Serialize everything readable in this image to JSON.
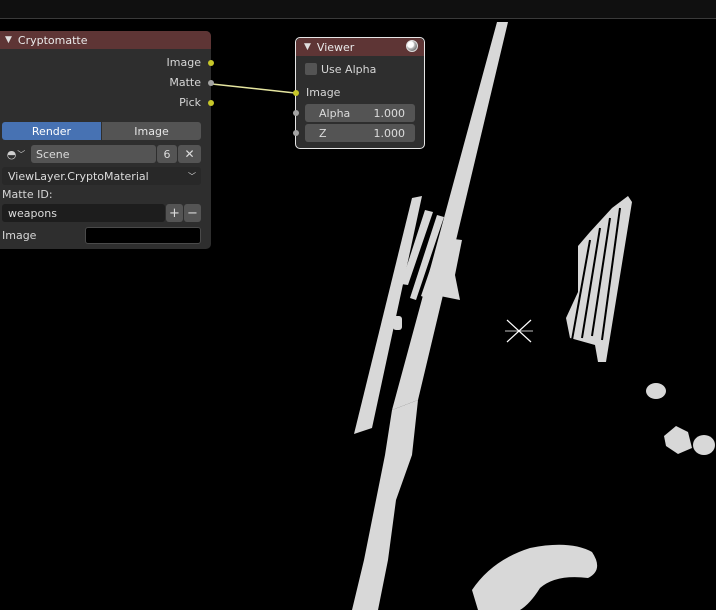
{
  "cryptomatte": {
    "title": "Cryptomatte",
    "outputs": [
      "Image",
      "Matte",
      "Pick"
    ],
    "source_tabs": [
      "Render",
      "Image"
    ],
    "active_tab": "Render",
    "scene": {
      "name": "Scene",
      "users": "6"
    },
    "layer": "ViewLayer.CryptoMaterial",
    "matte_id_label": "Matte ID:",
    "matte_id_value": "weapons",
    "image_label": "Image"
  },
  "viewer": {
    "title": "Viewer",
    "use_alpha_label": "Use Alpha",
    "use_alpha": false,
    "image_label": "Image",
    "alpha_label": "Alpha",
    "alpha_value": "1.000",
    "z_label": "Z",
    "z_value": "1.000"
  },
  "icons": {
    "collapse": "chevron-down-icon",
    "viewer_node": "viewer-sphere-icon",
    "scene": "scene-icon",
    "close": "close-icon",
    "add": "plus-icon",
    "remove": "minus-icon",
    "cursor": "backdrop-center-cursor-icon"
  },
  "colors": {
    "node_header": "#5e3535",
    "node_body": "#2e2e2e",
    "socket_color": "#c7c729",
    "socket_value": "#a3a3a3",
    "active_button": "#4772b3",
    "matte_white": "#d8d8d8",
    "background": "#000000"
  }
}
